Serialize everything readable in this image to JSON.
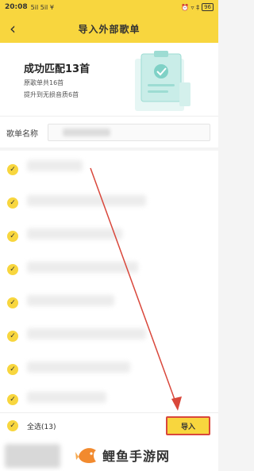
{
  "status_bar": {
    "time": "20:08",
    "signal": "5il 5il ¥",
    "right_icons": "⏰ ▿ ‡",
    "battery": "96"
  },
  "header": {
    "back_icon": "chevron-left",
    "title": "导入外部歌单"
  },
  "summary": {
    "headline": "成功匹配13首",
    "line1": "原歌单共16首",
    "line2": "提升到无损音质6首"
  },
  "name_row": {
    "label": "歌单名称"
  },
  "song_list": {
    "rows": [
      {
        "checked": true
      },
      {
        "checked": true
      },
      {
        "checked": true
      },
      {
        "checked": true
      },
      {
        "checked": true
      },
      {
        "checked": true
      },
      {
        "checked": true
      },
      {
        "checked": true
      }
    ]
  },
  "bottom_bar": {
    "select_all": "全选(13)",
    "import_button": "导入"
  },
  "watermark": {
    "text": "鲤鱼手游网"
  },
  "colors": {
    "accent_yellow": "#f8d63e",
    "annotation_red": "#d9473b"
  }
}
